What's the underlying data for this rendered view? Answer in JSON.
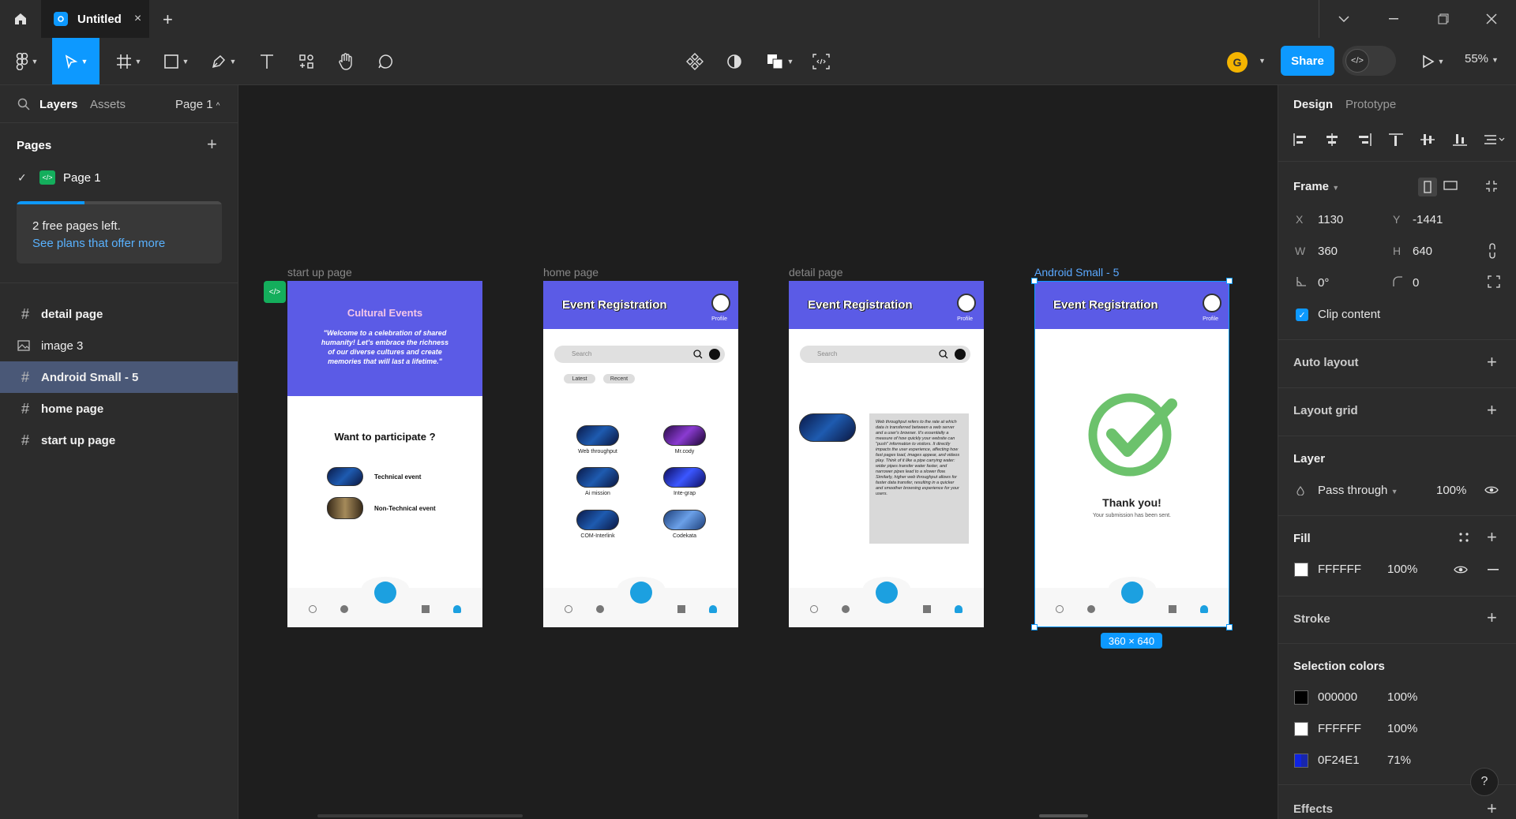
{
  "titlebar": {
    "tab_title": "Untitled",
    "close_glyph": "×",
    "new_tab_glyph": "+"
  },
  "toolbar": {
    "avatar_initial": "G",
    "share_label": "Share",
    "zoom": "55%"
  },
  "left_panel": {
    "tabs": {
      "layers": "Layers",
      "assets": "Assets",
      "page_selector": "Page 1"
    },
    "pages_title": "Pages",
    "pages": [
      {
        "label": "Page 1"
      }
    ],
    "notice": {
      "text": "2 free pages left.",
      "link": "See plans that offer more",
      "used_fraction": 0.33
    },
    "layers": [
      {
        "label": "detail page",
        "icon": "frame-icon"
      },
      {
        "label": "image 3",
        "icon": "image-icon"
      },
      {
        "label": "Android Small - 5",
        "icon": "frame-icon"
      },
      {
        "label": "home page",
        "icon": "frame-icon"
      },
      {
        "label": "start up page",
        "icon": "frame-icon"
      }
    ]
  },
  "canvas": {
    "frames": {
      "startup": {
        "label": "start up page",
        "title": "Cultural Events",
        "welcome": "\"Welcome to a celebration of shared humanity! Let's embrace the richness of our diverse cultures and create memories that will last a lifetime.\"",
        "question": "Want to participate ?",
        "option1": "Technical event",
        "option2": "Non-Technical event"
      },
      "home": {
        "label": "home page",
        "title": "Event Registration",
        "profile": "Profile",
        "search_placeholder": "Search",
        "chips": [
          "Latest",
          "Recent"
        ],
        "items": [
          "Web throughput",
          "Mr.cody",
          "Ai mission",
          "Inte-grap",
          "COM-Interlink",
          "Codekata"
        ]
      },
      "detail": {
        "label": "detail page",
        "title": "Event Registration",
        "profile": "Profile",
        "search_placeholder": "Search",
        "description": "Web throughput refers to the rate at which data is transferred between a web server and a user's browser. It's essentially a measure of how quickly your website can \"push\" information to visitors. It directly impacts the user experience, affecting how fast pages load, images appear, and videos play. Think of it like a pipe carrying water: wider pipes transfer water faster, and narrower pipes lead to a slower flow. Similarly, higher web throughput allows for faster data transfer, resulting in a quicker and smoother browsing experience for your users."
      },
      "android": {
        "label": "Android Small - 5",
        "title": "Event Registration",
        "profile": "Profile",
        "thanks": "Thank you!",
        "sent": "Your submission has been sent.",
        "size_badge": "360 × 640"
      }
    }
  },
  "right_panel": {
    "tabs": {
      "design": "Design",
      "prototype": "Prototype"
    },
    "frame": {
      "title": "Frame",
      "x_label": "X",
      "x": "1130",
      "y_label": "Y",
      "y": "-1441",
      "w_label": "W",
      "w": "360",
      "h_label": "H",
      "h": "640",
      "rotation": "0°",
      "radius": "0",
      "clip_label": "Clip content"
    },
    "auto_layout": "Auto layout",
    "layout_grid": "Layout grid",
    "layer": {
      "title": "Layer",
      "blend": "Pass through",
      "opacity": "100%"
    },
    "fill": {
      "title": "Fill",
      "hex": "FFFFFF",
      "opacity": "100%"
    },
    "stroke": "Stroke",
    "selection_colors": {
      "title": "Selection colors",
      "items": [
        {
          "hex": "000000",
          "opacity": "100%",
          "color": "#000000"
        },
        {
          "hex": "FFFFFF",
          "opacity": "100%",
          "color": "#FFFFFF"
        },
        {
          "hex": "0F24E1",
          "opacity": "71%",
          "color": "#0F24E1"
        }
      ]
    },
    "effects": "Effects",
    "help": "?"
  },
  "colors": {
    "accent": "#0d99ff",
    "frame_header": "#5b5be6",
    "selected_layer": "#4a5877",
    "check_green": "#6cc26c",
    "fab": "#1ca0e0"
  }
}
